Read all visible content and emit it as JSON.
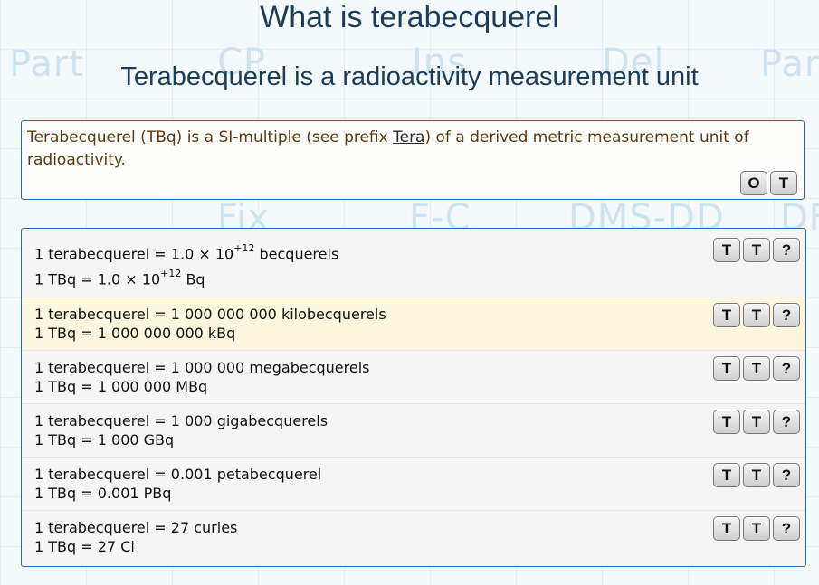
{
  "title": "What is terabecquerel",
  "subtitle": "Terabecquerel is a radioactivity measurement unit",
  "background_words": [
    "Part",
    "CP",
    "Ins",
    "Del",
    "Par",
    "Fix",
    "F-C",
    "DMS-DD",
    "DF"
  ],
  "description": {
    "before_link": "Terabecquerel (TBq) is a SI-multiple (see prefix ",
    "link_text": "Tera",
    "after_link": ") of a derived metric measurement unit of radioactivity.",
    "buttons": [
      "O",
      "T"
    ]
  },
  "conversions": [
    {
      "line1_prefix": "1 terabecquerel = 1.0 × 10",
      "line1_sup": "+12",
      "line1_suffix": " becquerels",
      "line2_prefix": "1 TBq = 1.0 × 10",
      "line2_sup": "+12",
      "line2_suffix": " Bq",
      "buttons": [
        "T",
        "T",
        "?"
      ],
      "highlighted": false
    },
    {
      "line1": "1 terabecquerel = 1 000 000 000 kilobecquerels",
      "line2": "1 TBq = 1 000 000 000 kBq",
      "buttons": [
        "T",
        "T",
        "?"
      ],
      "highlighted": true
    },
    {
      "line1": "1 terabecquerel = 1 000 000 megabecquerels",
      "line2": "1 TBq = 1 000 000 MBq",
      "buttons": [
        "T",
        "T",
        "?"
      ],
      "highlighted": false
    },
    {
      "line1": "1 terabecquerel = 1 000 gigabecquerels",
      "line2": "1 TBq = 1 000 GBq",
      "buttons": [
        "T",
        "T",
        "?"
      ],
      "highlighted": false
    },
    {
      "line1": "1 terabecquerel = 0.001 petabecquerel",
      "line2": "1 TBq = 0.001 PBq",
      "buttons": [
        "T",
        "T",
        "?"
      ],
      "highlighted": false
    },
    {
      "line1": "1 terabecquerel = 27 curies",
      "line2": "1 TBq = 27 Ci",
      "buttons": [
        "T",
        "T",
        "?"
      ],
      "highlighted": false
    }
  ],
  "colors": {
    "border": "#2f6aa8",
    "title": "#1d3c5a",
    "highlight_row": "#fbf6dd",
    "desc_text": "#5a3c10"
  }
}
